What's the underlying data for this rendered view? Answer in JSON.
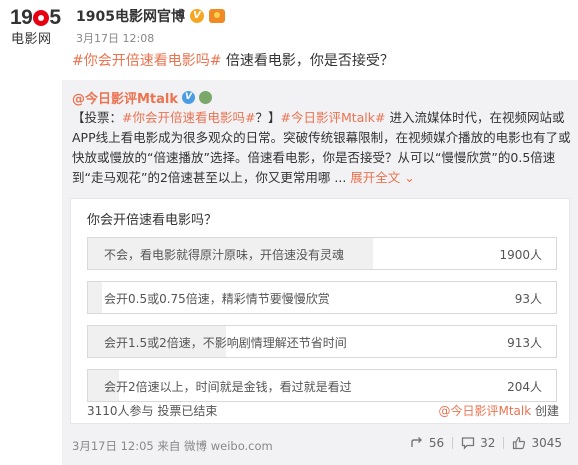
{
  "header": {
    "logo_top": "1905",
    "logo_bottom": "电影网",
    "author": "1905电影网官博",
    "time": "3月17日 12:08",
    "post_tag": "#你会开倍速看电影吗#",
    "post_text": " 倍速看电影，你是否接受？"
  },
  "repost": {
    "author": "@今日影评Mtalk",
    "body_prefix": "【投票：",
    "body_tag1": "#你会开倍速看电影吗#",
    "body_mid1": "？】",
    "body_tag2": "#今日影评Mtalk#",
    "body_rest": " 进入流媒体时代，在视频网站或APP线上看电影成为很多观众的日常。突破传统银幕限制，在视频媒介播放的电影也有了或快放或慢放的“倍速播放”选择。倍速看电影，你是否接受？从可以“慢慢欣赏”的0.5倍速到“走马观花”的2倍速甚至以上，你又更常用哪 ... ",
    "expand": "展开全文 ⌄",
    "poll": {
      "title": "你会开倍速看电影吗？",
      "options": [
        {
          "label": "不会，看电影就得原汁原味，开倍速没有灵魂",
          "count": "1900人",
          "share": 0.61
        },
        {
          "label": "会开0.5或0.75倍速，精彩情节要慢慢欣赏",
          "count": "93人",
          "share": 0.03
        },
        {
          "label": "会开1.5或2倍速，不影响剧情理解还节省时间",
          "count": "913人",
          "share": 0.294
        },
        {
          "label": "会开2倍速以上，时间就是金钱，看过就是看过",
          "count": "204人",
          "share": 0.066
        }
      ],
      "summary": "3110人参与  投票已结束",
      "creator": "@今日影评Mtalk",
      "creator_suffix": " 创建"
    },
    "footer": "3月17日 12:05 来自 微博 weibo.com",
    "actions": {
      "reposts": "56",
      "comments": "32",
      "likes": "3045"
    }
  }
}
